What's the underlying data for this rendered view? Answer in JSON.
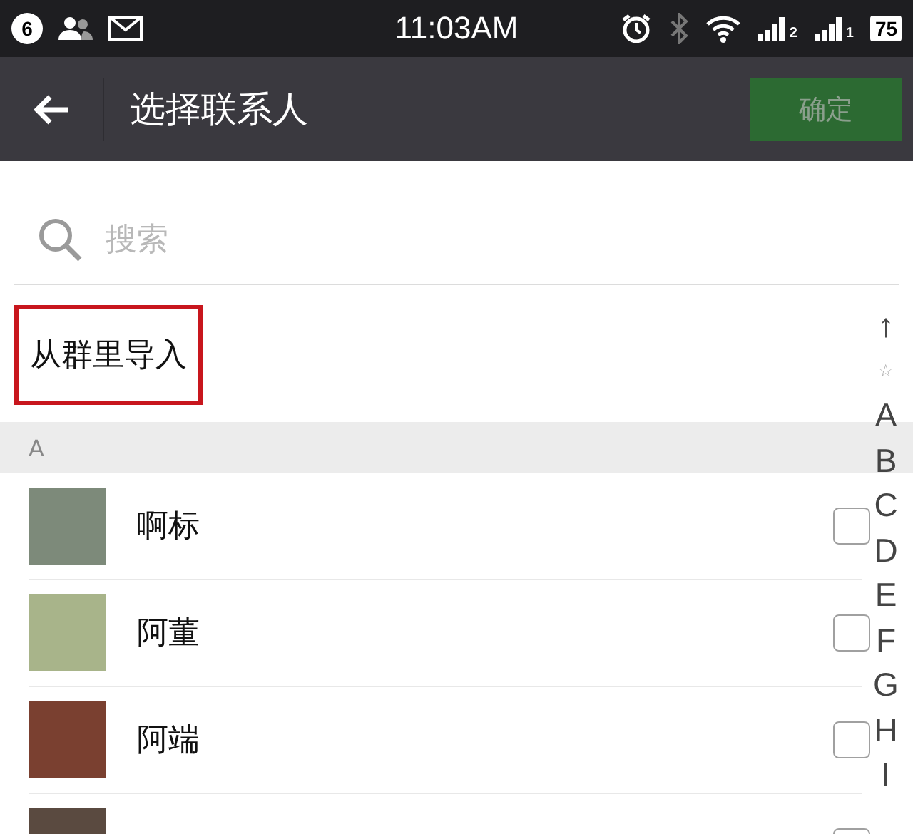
{
  "status_bar": {
    "notification_count": "6",
    "time": "11:03AM",
    "sim_1_label": "2",
    "sim_2_label": "1",
    "battery": "75"
  },
  "header": {
    "title": "选择联系人",
    "confirm_button": {
      "label": "确定",
      "disabled": true
    }
  },
  "search": {
    "placeholder": "搜索"
  },
  "import_item": {
    "label": "从群里导入",
    "highlighted": true
  },
  "sections": [
    {
      "header": "A",
      "contacts": [
        {
          "name": "啊标",
          "checked": false
        },
        {
          "name": "阿董",
          "checked": false
        },
        {
          "name": "阿端",
          "checked": false
        },
        {
          "checked": false
        }
      ]
    }
  ],
  "index_bar": [
    "↑",
    "☆",
    "A",
    "B",
    "C",
    "D",
    "E",
    "F",
    "G",
    "H",
    "I"
  ]
}
